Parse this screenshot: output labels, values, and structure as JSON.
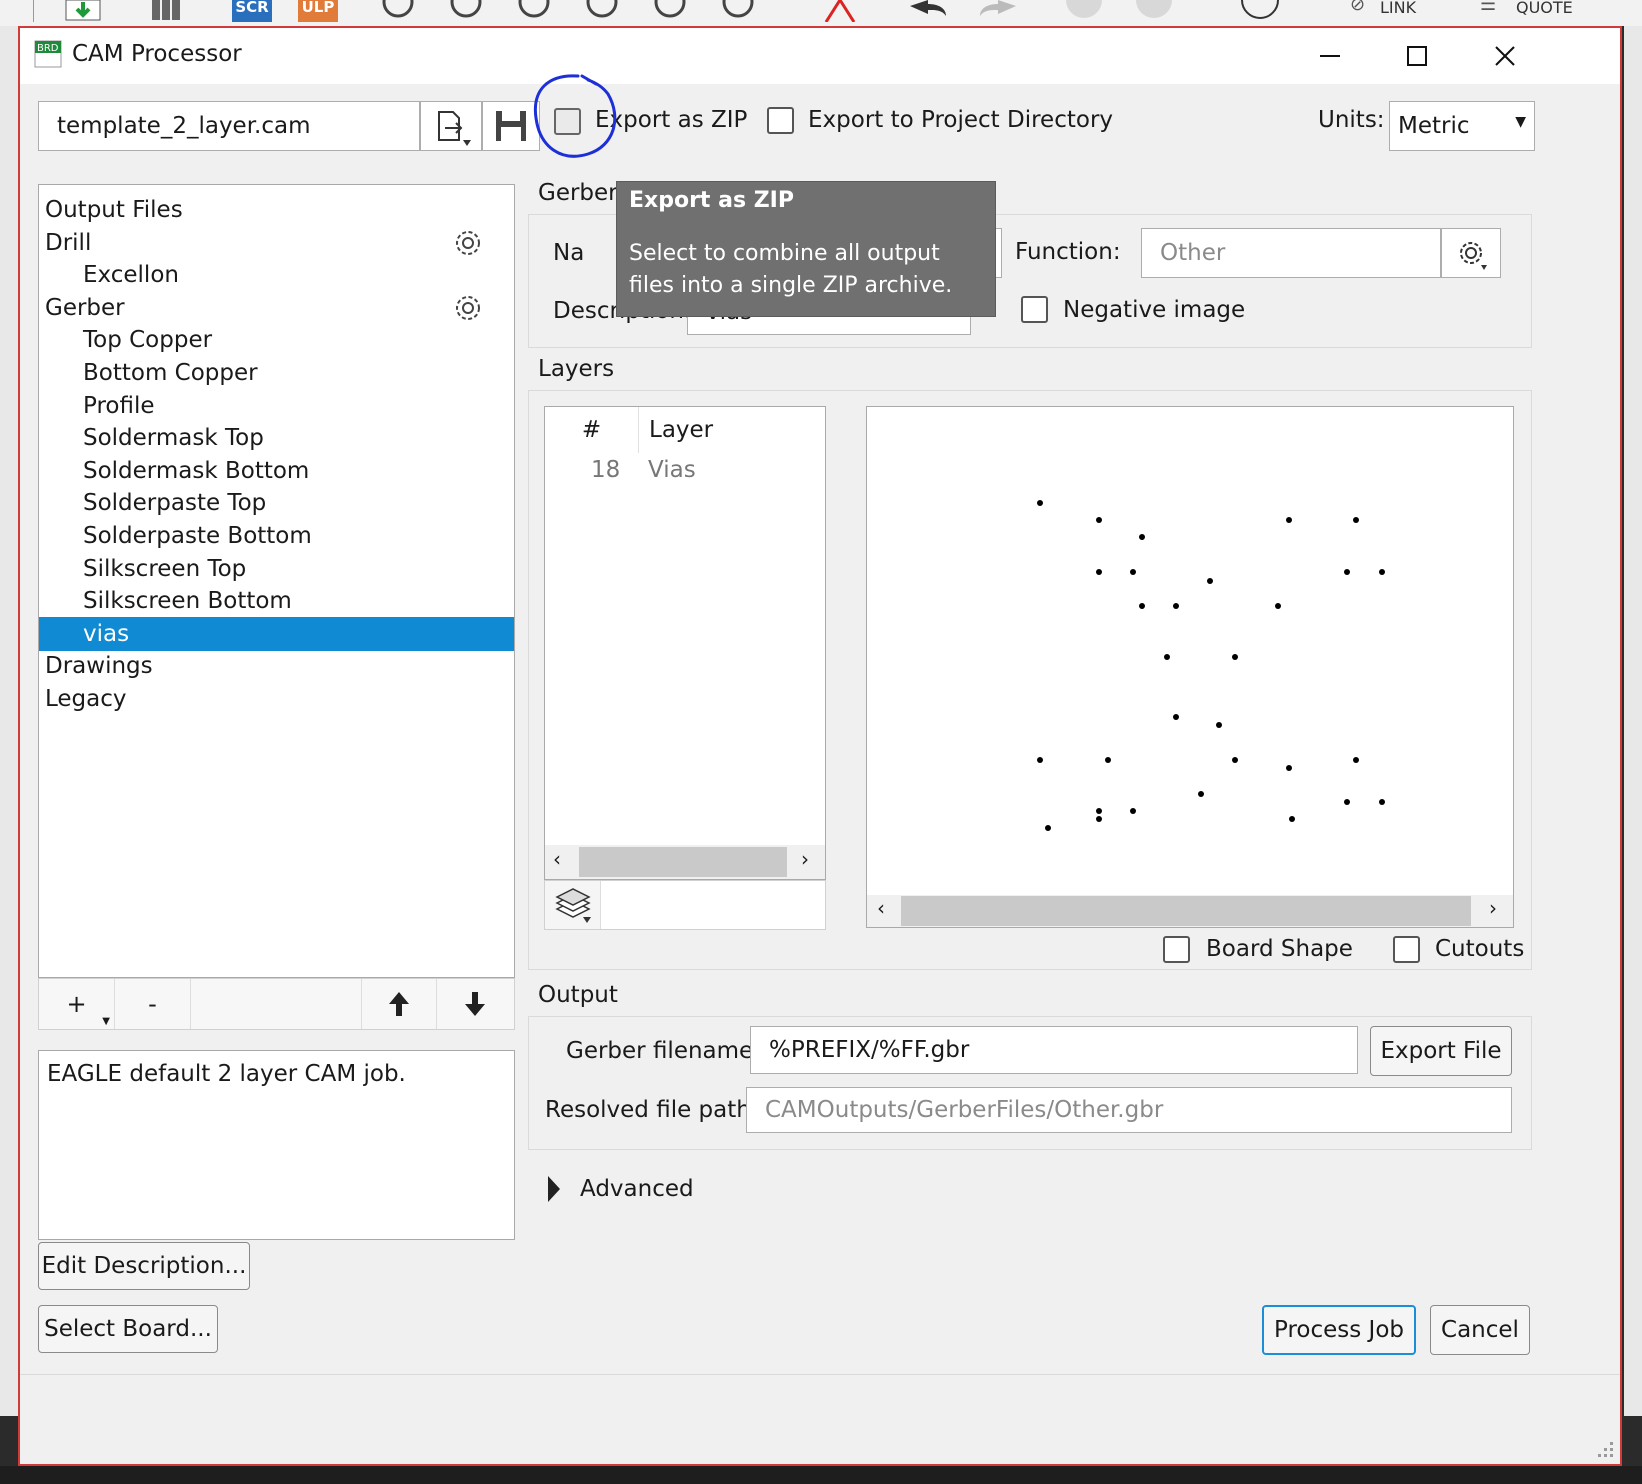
{
  "background_toolbar": {
    "items": [
      {
        "label": "SCR",
        "color": "#2a6fbd"
      },
      {
        "label": "ULP",
        "color": "#e07b39"
      }
    ],
    "link_label": "LINK",
    "quote_label": "QUOTE"
  },
  "window": {
    "title": "CAM Processor",
    "icon_label": "BRD"
  },
  "toolbar": {
    "job_file": "template_2_layer.cam",
    "export_zip_label": "Export as ZIP",
    "export_project_dir_label": "Export to Project Directory",
    "units_label": "Units:",
    "units_value": "Metric"
  },
  "tooltip": {
    "title": "Export as ZIP",
    "body": "Select to combine all output files into a single ZIP archive."
  },
  "tree": {
    "items": [
      {
        "label": "Output Files",
        "level": 0
      },
      {
        "label": "Drill",
        "level": 0,
        "gear": true
      },
      {
        "label": "Excellon",
        "level": 1
      },
      {
        "label": "Gerber",
        "level": 0,
        "gear": true
      },
      {
        "label": "Top Copper",
        "level": 1
      },
      {
        "label": "Bottom Copper",
        "level": 1
      },
      {
        "label": "Profile",
        "level": 1
      },
      {
        "label": "Soldermask Top",
        "level": 1
      },
      {
        "label": "Soldermask Bottom",
        "level": 1
      },
      {
        "label": "Solderpaste Top",
        "level": 1
      },
      {
        "label": "Solderpaste Bottom",
        "level": 1
      },
      {
        "label": "Silkscreen Top",
        "level": 1
      },
      {
        "label": "Silkscreen Bottom",
        "level": 1
      },
      {
        "label": "vias",
        "level": 1,
        "selected": true
      },
      {
        "label": "Drawings",
        "level": 0
      },
      {
        "label": "Legacy",
        "level": 0
      }
    ]
  },
  "tree_toolbar": {
    "add_label": "+",
    "remove_label": "-"
  },
  "description_box": {
    "text": "EAGLE default 2 layer CAM job.",
    "edit_button": "Edit Description...",
    "select_board_button": "Select Board..."
  },
  "gerber_file": {
    "section_label": "Gerber File",
    "name_label": "Na",
    "function_label": "Function:",
    "function_value": "Other",
    "description_label": "Description:",
    "description_value": "vias",
    "negative_image_label": "Negative image"
  },
  "layers": {
    "section_label": "Layers",
    "columns": [
      "#",
      "Layer"
    ],
    "rows": [
      {
        "num": "18",
        "name": "Vias"
      }
    ],
    "board_shape_label": "Board Shape",
    "cutouts_label": "Cutouts"
  },
  "output": {
    "section_label": "Output",
    "gerber_filename_label": "Gerber filename:",
    "gerber_filename_value": "%PREFIX/%FF.gbr",
    "export_file_button": "Export File",
    "resolved_path_label": "Resolved file path:",
    "resolved_path_value": "CAMOutputs/GerberFiles/Other.gbr"
  },
  "advanced": {
    "label": "Advanced"
  },
  "footer": {
    "process_job_button": "Process Job",
    "cancel_button": "Cancel"
  },
  "colors": {
    "selection": "#0f8ad3",
    "tooltip_bg": "#707070",
    "annotation": "#1d2fd6",
    "window_border": "#d23a3a",
    "primary_button_border": "#1a8fd8"
  }
}
